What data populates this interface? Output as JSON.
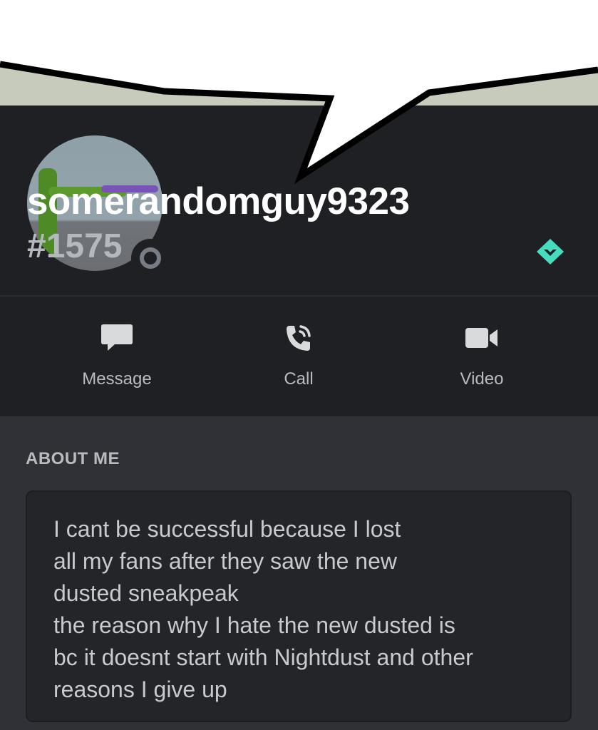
{
  "profile": {
    "username": "somerandomguy9323",
    "discriminator": "#1575",
    "status": "offline",
    "badge_icon": "hypesquad-diamond-icon",
    "badge_color": "#45ddc0"
  },
  "actions": [
    {
      "label": "Message",
      "icon": "message-icon"
    },
    {
      "label": "Call",
      "icon": "phone-call-icon"
    },
    {
      "label": "Video",
      "icon": "video-camera-icon"
    }
  ],
  "about": {
    "title": "ABOUT ME",
    "lines": [
      "I cant be successful because I lost",
      "all my fans after they saw the new",
      "dusted sneakpeak",
      "the reason why I hate the new dusted is",
      "bc it doesnt start with Nightdust and other",
      "reasons I give up"
    ]
  },
  "colors": {
    "header_bg": "#1f2024",
    "body_bg": "#303136",
    "text_primary": "#ffffff",
    "text_muted": "#b9bbbe",
    "banner": "#c6cbbc"
  }
}
